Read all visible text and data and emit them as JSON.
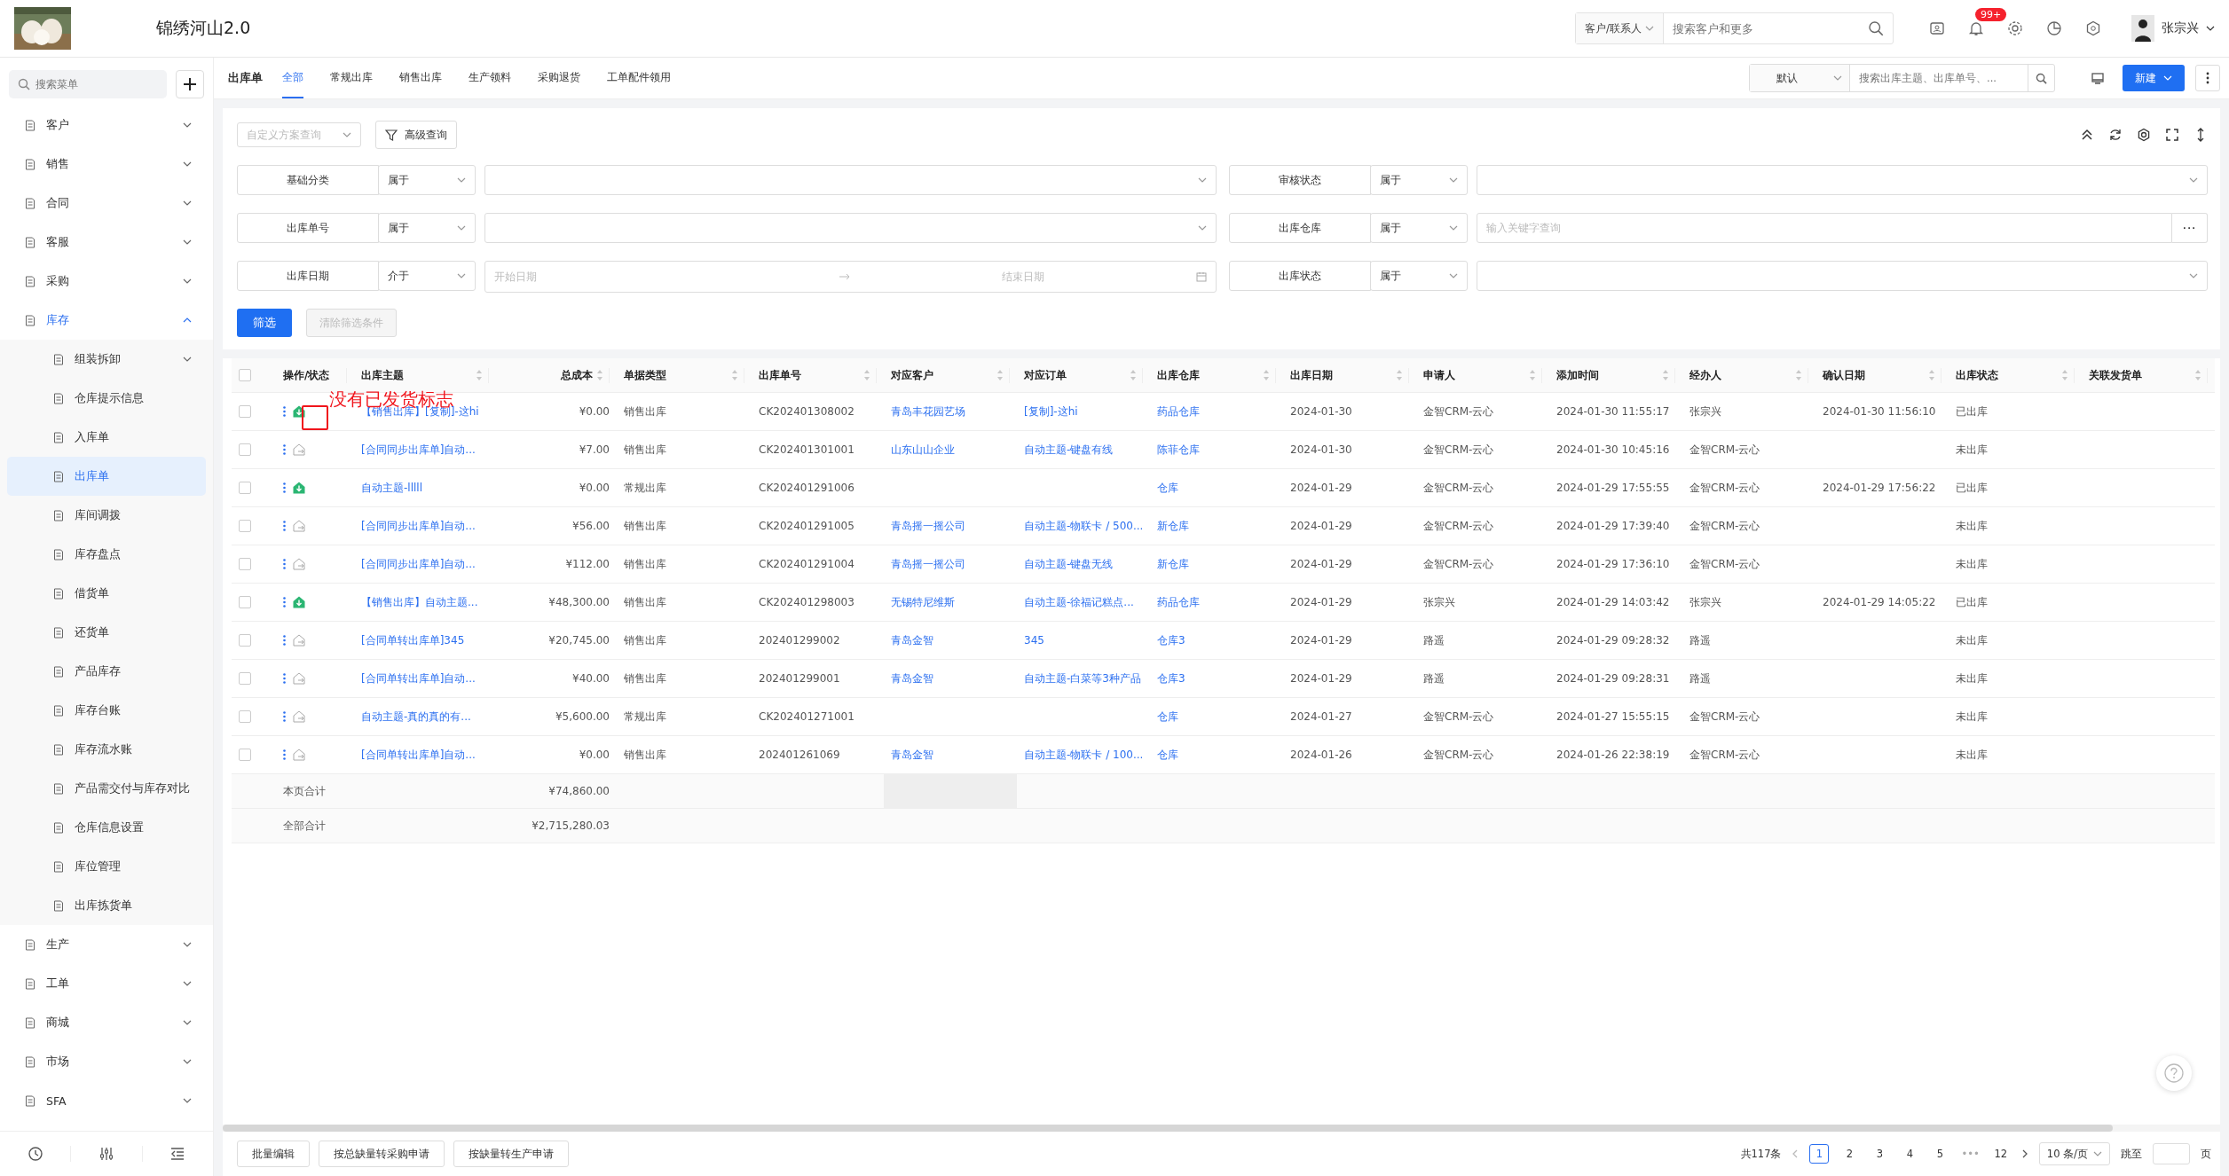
{
  "app": {
    "title": "锦绣河山2.0"
  },
  "topbar": {
    "scope_select": "客户/联系人",
    "search": {
      "placeholder": "搜索客户和更多"
    },
    "notification_badge": "99+",
    "user": "张宗兴"
  },
  "sidebar": {
    "search": {
      "placeholder": "搜索菜单"
    },
    "items": [
      {
        "label": "客户",
        "expanded": false
      },
      {
        "label": "销售",
        "expanded": false
      },
      {
        "label": "合同",
        "expanded": false
      },
      {
        "label": "客服",
        "expanded": false
      },
      {
        "label": "采购",
        "expanded": false
      },
      {
        "label": "库存",
        "expanded": true,
        "children": [
          {
            "label": "组装拆卸",
            "selected": false,
            "expanded": false
          },
          {
            "label": "仓库提示信息",
            "selected": false
          },
          {
            "label": "入库单",
            "selected": false
          },
          {
            "label": "出库单",
            "selected": true
          },
          {
            "label": "库间调拨",
            "selected": false
          },
          {
            "label": "库存盘点",
            "selected": false
          },
          {
            "label": "借货单",
            "selected": false
          },
          {
            "label": "还货单",
            "selected": false
          },
          {
            "label": "产品库存",
            "selected": false
          },
          {
            "label": "库存台账",
            "selected": false
          },
          {
            "label": "库存流水账",
            "selected": false
          },
          {
            "label": "产品需交付与库存对比",
            "selected": false
          },
          {
            "label": "仓库信息设置",
            "selected": false
          },
          {
            "label": "库位管理",
            "selected": false
          },
          {
            "label": "出库拣货单",
            "selected": false
          }
        ]
      },
      {
        "label": "生产",
        "expanded": false
      },
      {
        "label": "工单",
        "expanded": false
      },
      {
        "label": "商城",
        "expanded": false
      },
      {
        "label": "市场",
        "expanded": false
      },
      {
        "label": "SFA",
        "expanded": false
      }
    ]
  },
  "page": {
    "title": "出库单",
    "tabs": [
      {
        "label": "全部",
        "selected": true
      },
      {
        "label": "常规出库",
        "selected": false
      },
      {
        "label": "销售出库",
        "selected": false
      },
      {
        "label": "生产领料",
        "selected": false
      },
      {
        "label": "采购退货",
        "selected": false
      },
      {
        "label": "工单配件领用",
        "selected": false
      }
    ],
    "view_select": "默认",
    "search": {
      "placeholder": "搜索出库主题、出库单号、..."
    },
    "new_button": "新建"
  },
  "filters": {
    "scheme_select": {
      "placeholder": "自定义方案查询"
    },
    "advanced_button": "高级查询",
    "conditions": [
      {
        "label": "基础分类",
        "operator": "属于",
        "kind": "select"
      },
      {
        "label": "审核状态",
        "operator": "属于",
        "kind": "select"
      },
      {
        "label": "出库单号",
        "operator": "属于",
        "kind": "select"
      },
      {
        "label": "出库仓库",
        "operator": "属于",
        "kind": "keyword",
        "placeholder": "输入关键字查询",
        "more": "···"
      },
      {
        "label": "出库日期",
        "operator": "介于",
        "kind": "date_range",
        "start_placeholder": "开始日期",
        "end_placeholder": "结束日期"
      },
      {
        "label": "出库状态",
        "operator": "属于",
        "kind": "select"
      }
    ],
    "apply_button": "筛选",
    "clear_button": {
      "label": "清除筛选条件",
      "disabled": true
    }
  },
  "table": {
    "select_all": {
      "checked": false
    },
    "columns": [
      {
        "label": "操作/状态"
      },
      {
        "label": "出库主题"
      },
      {
        "label": "总成本"
      },
      {
        "label": "单据类型"
      },
      {
        "label": "出库单号"
      },
      {
        "label": "对应客户"
      },
      {
        "label": "对应订单"
      },
      {
        "label": "出库仓库"
      },
      {
        "label": "出库日期"
      },
      {
        "label": "申请人"
      },
      {
        "label": "添加时间"
      },
      {
        "label": "经办人"
      },
      {
        "label": "确认日期"
      },
      {
        "label": "出库状态"
      },
      {
        "label": "关联发货单"
      }
    ],
    "rows": [
      {
        "checked": false,
        "shipped": true,
        "subject": "【销售出库】[复制]-这hi",
        "total_cost": "¥0.00",
        "type": "销售出库",
        "number": "CK202401308002",
        "customer": "青岛丰花园艺场",
        "order": "[复制]-这hi",
        "warehouse": "药品仓库",
        "date": "2024-01-30",
        "applicant": "金智CRM-云心",
        "added": "2024-01-30 11:55:17",
        "handler": "张宗兴",
        "confirmed": "2024-01-30 11:56:10",
        "status": "已出库"
      },
      {
        "checked": false,
        "shipped": false,
        "subject": "[合同同步出库单]自动...",
        "total_cost": "¥7.00",
        "type": "销售出库",
        "number": "CK202401301001",
        "customer": "山东山山企业",
        "order": "自动主题-键盘有线",
        "warehouse": "陈菲仓库",
        "date": "2024-01-30",
        "applicant": "金智CRM-云心",
        "added": "2024-01-30 10:45:16",
        "handler": "金智CRM-云心",
        "status": "未出库"
      },
      {
        "checked": false,
        "shipped": true,
        "subject": "自动主题-lllll",
        "total_cost": "¥0.00",
        "type": "常规出库",
        "number": "CK202401291006",
        "warehouse": "仓库",
        "date": "2024-01-29",
        "applicant": "金智CRM-云心",
        "added": "2024-01-29 17:55:55",
        "handler": "金智CRM-云心",
        "confirmed": "2024-01-29 17:56:22",
        "status": "已出库"
      },
      {
        "checked": false,
        "shipped": false,
        "subject": "[合同同步出库单]自动...",
        "total_cost": "¥56.00",
        "type": "销售出库",
        "number": "CK202401291005",
        "customer": "青岛摇一摇公司",
        "order": "自动主题-物联卡 / 500...",
        "warehouse": "新仓库",
        "date": "2024-01-29",
        "applicant": "金智CRM-云心",
        "added": "2024-01-29 17:39:40",
        "handler": "金智CRM-云心",
        "status": "未出库"
      },
      {
        "checked": false,
        "shipped": false,
        "subject": "[合同同步出库单]自动...",
        "total_cost": "¥112.00",
        "type": "销售出库",
        "number": "CK202401291004",
        "customer": "青岛摇一摇公司",
        "order": "自动主题-键盘无线",
        "warehouse": "新仓库",
        "date": "2024-01-29",
        "applicant": "金智CRM-云心",
        "added": "2024-01-29 17:36:10",
        "handler": "金智CRM-云心",
        "status": "未出库"
      },
      {
        "checked": false,
        "shipped": true,
        "subject": "【销售出库】自动主题...",
        "total_cost": "¥48,300.00",
        "type": "销售出库",
        "number": "CK202401298003",
        "customer": "无锡特尼维斯",
        "order": "自动主题-徐福记糕点...",
        "warehouse": "药品仓库",
        "date": "2024-01-29",
        "applicant": "张宗兴",
        "added": "2024-01-29 14:03:42",
        "handler": "张宗兴",
        "confirmed": "2024-01-29 14:05:22",
        "status": "已出库"
      },
      {
        "checked": false,
        "shipped": false,
        "subject": "[合同单转出库单]345",
        "total_cost": "¥20,745.00",
        "type": "销售出库",
        "number": "202401299002",
        "customer": "青岛金智",
        "order": "345",
        "warehouse": "仓库3",
        "date": "2024-01-29",
        "applicant": "路遥",
        "added": "2024-01-29 09:28:32",
        "handler": "路遥",
        "status": "未出库"
      },
      {
        "checked": false,
        "shipped": false,
        "subject": "[合同单转出库单]自动...",
        "total_cost": "¥40.00",
        "type": "销售出库",
        "number": "202401299001",
        "customer": "青岛金智",
        "order": "自动主题-白菜等3种产品",
        "warehouse": "仓库3",
        "date": "2024-01-29",
        "applicant": "路遥",
        "added": "2024-01-29 09:28:31",
        "handler": "路遥",
        "status": "未出库"
      },
      {
        "checked": false,
        "shipped": false,
        "subject": "自动主题-真的真的有...",
        "total_cost": "¥5,600.00",
        "type": "常规出库",
        "number": "CK202401271001",
        "warehouse": "仓库",
        "date": "2024-01-27",
        "applicant": "金智CRM-云心",
        "added": "2024-01-27 15:55:15",
        "handler": "金智CRM-云心",
        "status": "未出库"
      },
      {
        "checked": false,
        "shipped": false,
        "subject": "[合同单转出库单]自动...",
        "total_cost": "¥0.00",
        "type": "销售出库",
        "number": "202401261069",
        "customer": "青岛金智",
        "order": "自动主题-物联卡 / 100...",
        "warehouse": "仓库",
        "date": "2024-01-26",
        "applicant": "金智CRM-云心",
        "added": "2024-01-26 22:38:19",
        "handler": "金智CRM-云心",
        "status": "未出库"
      }
    ],
    "totals": [
      {
        "label": "本页合计",
        "total_cost": "¥74,860.00"
      },
      {
        "label": "全部合计",
        "total_cost": "¥2,715,280.03"
      }
    ]
  },
  "annotation": {
    "text": "没有已发货标志"
  },
  "footer": {
    "buttons": [
      "批量编辑",
      "按总缺量转采购申请",
      "按缺量转生产申请"
    ],
    "pagination": {
      "total": "共117条",
      "pages": [
        {
          "label": "1",
          "kind": "page",
          "selected": true
        },
        {
          "label": "2",
          "kind": "page",
          "selected": false
        },
        {
          "label": "3",
          "kind": "page",
          "selected": false
        },
        {
          "label": "4",
          "kind": "page",
          "selected": false
        },
        {
          "label": "5",
          "kind": "page",
          "selected": false
        },
        {
          "label": "•••",
          "kind": "ellipsis"
        },
        {
          "label": "12",
          "kind": "page",
          "selected": false
        }
      ],
      "page_size": "10 条/页",
      "jump_label": "跳至",
      "jump_suffix": "页"
    }
  }
}
